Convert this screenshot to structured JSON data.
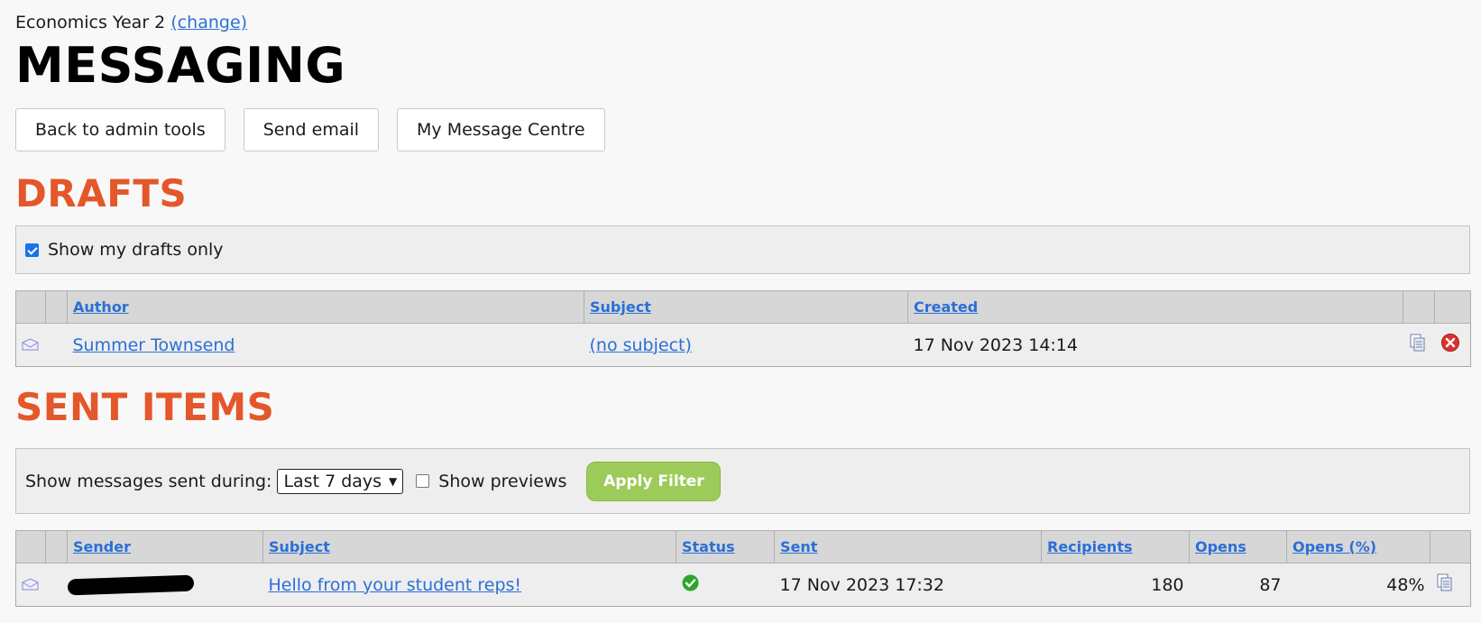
{
  "context": {
    "course": "Economics Year 2",
    "change_link": "(change)"
  },
  "page_title": "MESSAGING",
  "nav_buttons": {
    "back": "Back to admin tools",
    "send_email": "Send email",
    "message_centre": "My Message Centre"
  },
  "drafts": {
    "heading": "DRAFTS",
    "filter_label": "Show my drafts only",
    "filter_checked": true,
    "columns": {
      "author": "Author",
      "subject": "Subject",
      "created": "Created"
    },
    "rows": [
      {
        "author": "Summer Townsend",
        "subject": "(no subject)",
        "created": "17 Nov 2023 14:14"
      }
    ]
  },
  "sent": {
    "heading": "SENT ITEMS",
    "filter_label": "Show messages sent during:",
    "period_selected": "Last 7 days",
    "show_previews_label": "Show previews",
    "show_previews_checked": false,
    "apply_label": "Apply Filter",
    "columns": {
      "sender": "Sender",
      "subject": "Subject",
      "status": "Status",
      "sent": "Sent",
      "recipients": "Recipients",
      "opens": "Opens",
      "opens_pct": "Opens (%)"
    },
    "rows": [
      {
        "sender": "",
        "subject": "Hello from your student reps!",
        "status": "sent-ok-icon",
        "sent": "17 Nov 2023 17:32",
        "recipients": "180",
        "opens": "87",
        "opens_pct": "48%"
      }
    ]
  },
  "colors": {
    "heading_accent": "#e4572a",
    "link": "#2b6fd6",
    "apply_button": "#9dcb5a",
    "status_ok": "#2ea52e",
    "delete": "#d9322d"
  }
}
